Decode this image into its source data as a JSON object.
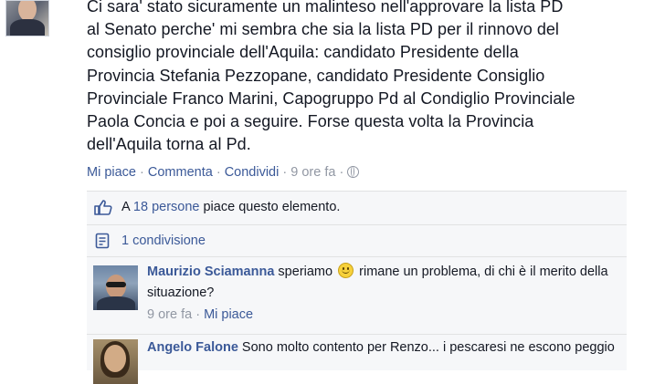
{
  "post": {
    "text": "Ci sara' stato sicuramente un malinteso nell'approvare la lista PD\nal Senato perche' mi sembra che sia la lista PD per il rinnovo del\nconsiglio provinciale dell'Aquila: candidato Presidente della\nProvincia Stefania Pezzopane, candidato Presidente Consiglio\nProvinciale Franco Marini, Capogruppo Pd al Condiglio Provinciale\nPaola Concia e poi a seguire. Forse questa volta la Provincia\ndell'Aquila torna al Pd.",
    "actions": {
      "like": "Mi piace",
      "comment": "Commenta",
      "share": "Condividi",
      "separator": "·",
      "time": "9 ore fa"
    }
  },
  "likes": {
    "prefix": "A ",
    "people": "18 persone",
    "suffix": " piace questo elemento."
  },
  "shares": {
    "label": "1 condivisione"
  },
  "comments": [
    {
      "author": "Maurizio Sciamanna",
      "text_before": " speriamo ",
      "text_after": " rimane un problema, di chi è il merito della situazione?",
      "time": "9 ore fa",
      "like": "Mi piace"
    },
    {
      "author": "Angelo Falone",
      "text": " Sono molto contento per Renzo... i pescaresi ne escono peggio"
    }
  ],
  "icons": {
    "globe": "globe-icon",
    "thumb": "thumbs-up-icon",
    "share": "share-icon",
    "smiley": "smiley-icon"
  },
  "colors": {
    "link": "#3b5998",
    "meta": "#9197a3",
    "text": "#141823",
    "panel": "#f6f7f9"
  }
}
